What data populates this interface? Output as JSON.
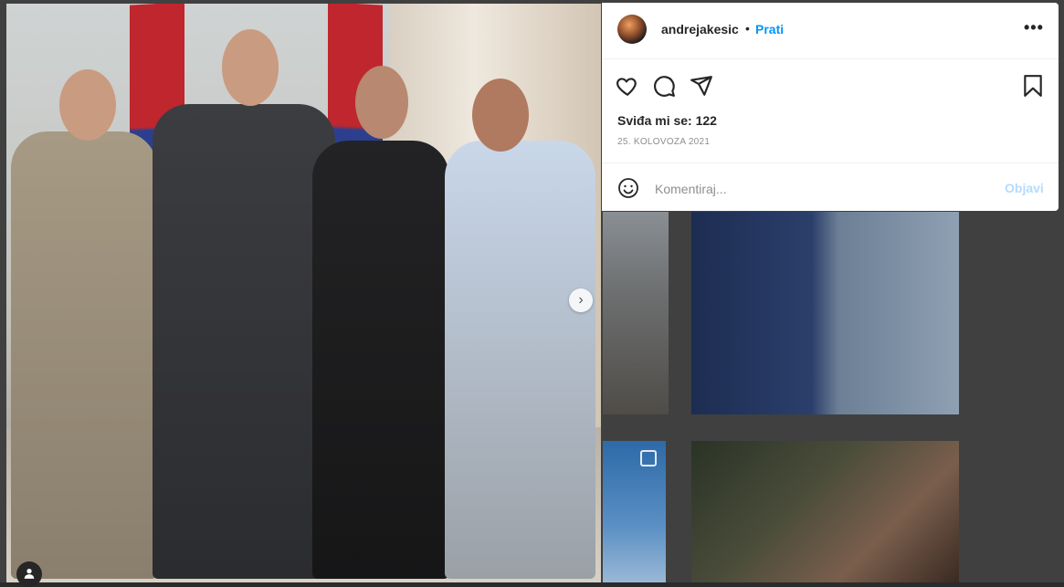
{
  "post": {
    "username": "andrejakesic",
    "separator": "•",
    "follow_label": "Prati",
    "more_label": "•••",
    "likes_text": "Sviđa mi se: 122",
    "date_text": "25. KOLOVOZA 2021"
  },
  "comment": {
    "placeholder": "Komentiraj...",
    "post_label": "Objavi"
  },
  "carousel": {
    "next_glyph": "›",
    "tag_glyph": "👤"
  },
  "icons": [
    "heart-icon",
    "comment-icon",
    "share-icon",
    "bookmark-icon",
    "emoji-icon",
    "chevron-right-icon",
    "user-tag-icon",
    "multiple-posts-icon"
  ],
  "colors": {
    "link_blue": "#0095f6",
    "post_disabled": "#b3dbff",
    "text": "#262626",
    "muted": "#8e8e8e"
  }
}
